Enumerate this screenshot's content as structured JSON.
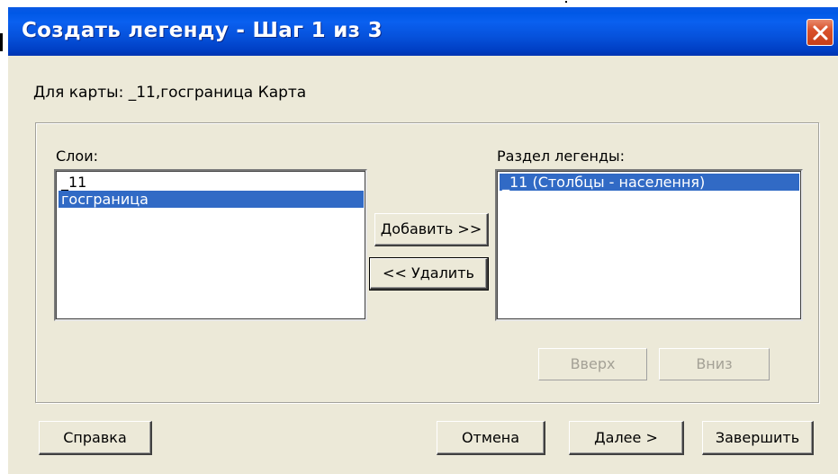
{
  "window": {
    "title": "Создать легенду - Шаг 1 из 3",
    "close_icon": "close-icon"
  },
  "for_map": "Для карты:  _11,госграница Карта",
  "layers": {
    "label": "Слои:",
    "items": [
      {
        "label": "_11",
        "selected": false
      },
      {
        "label": "госграница",
        "selected": true
      }
    ]
  },
  "legend_section": {
    "label": "Раздел легенды:",
    "items": [
      {
        "label": "_11 (Столбцы - населення)",
        "selected": true
      }
    ]
  },
  "buttons": {
    "add": "Добавить >>",
    "remove": "<< Удалить",
    "up": "Вверх",
    "down": "Вниз",
    "help": "Справка",
    "cancel": "Отмена",
    "next": "Далее >",
    "finish": "Завершить"
  },
  "colors": {
    "titlebar": "#0a5ae4",
    "selection": "#316ac5",
    "dialog_bg": "#ece9d8",
    "close_button": "#d9522c"
  }
}
